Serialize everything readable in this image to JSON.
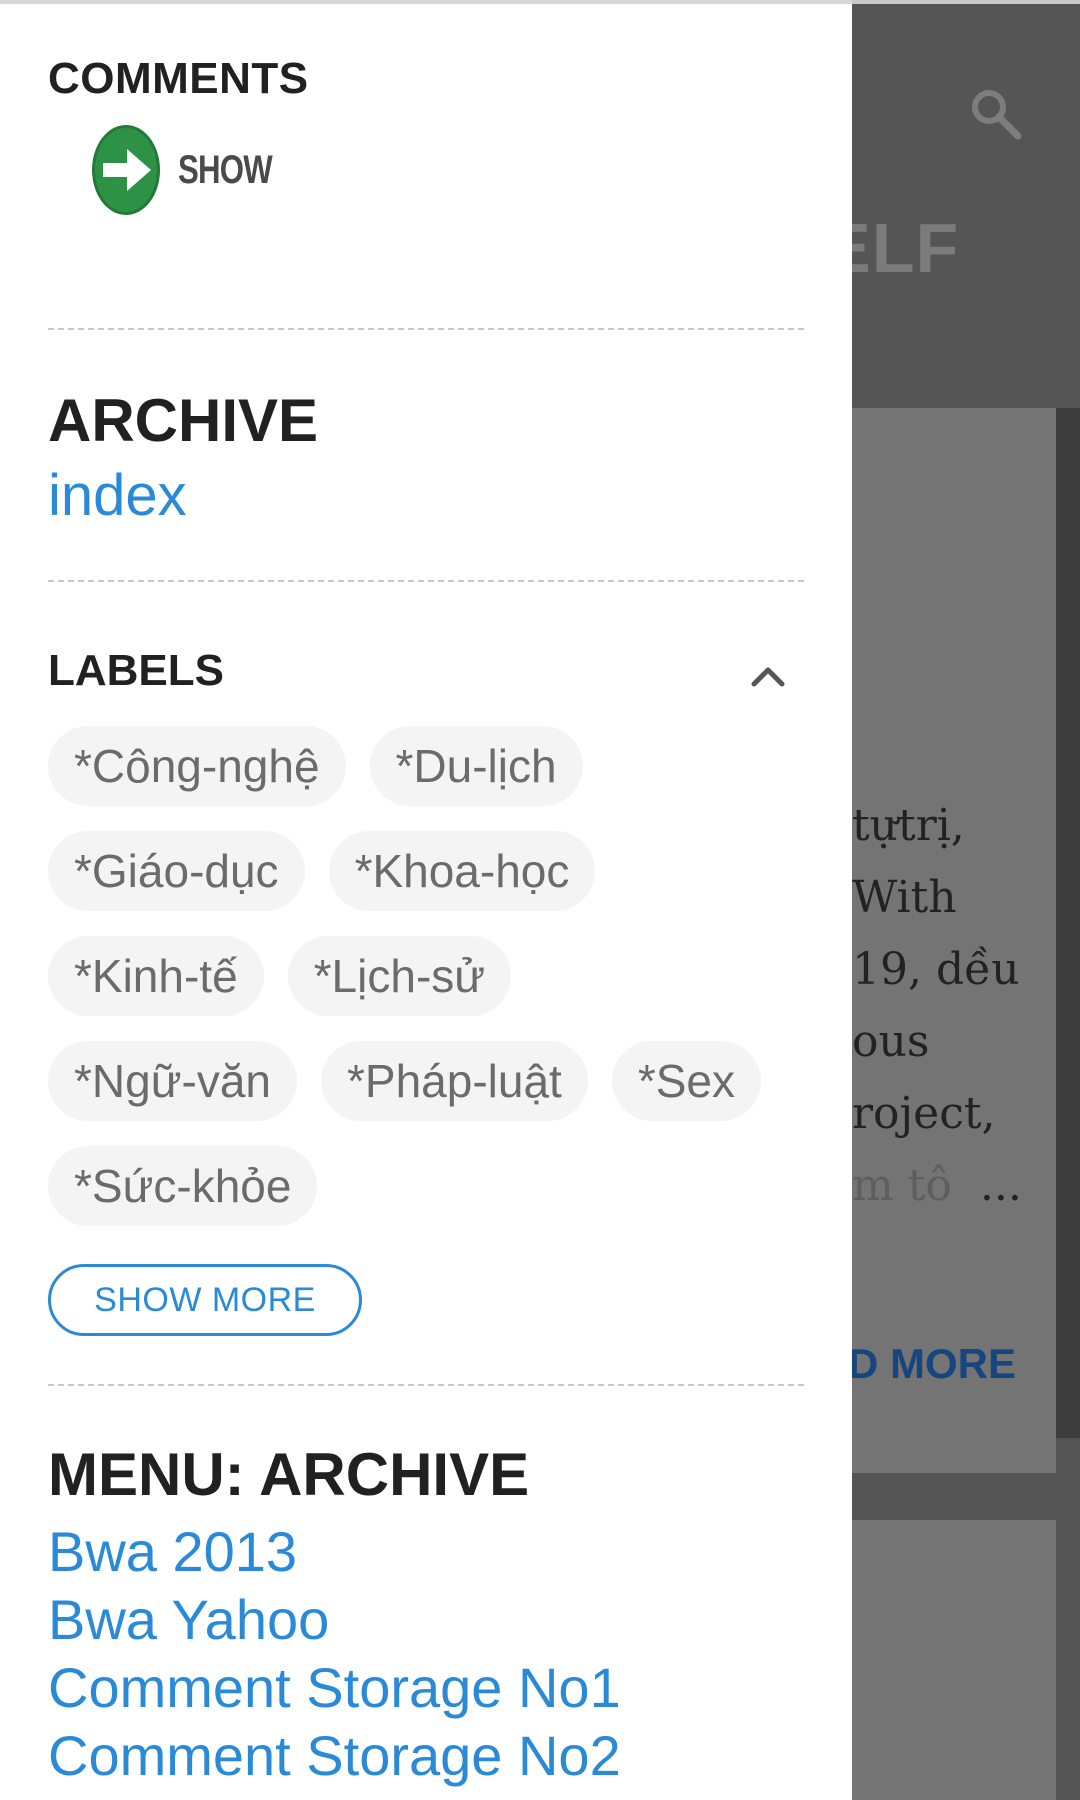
{
  "background": {
    "title_partial": "ELF",
    "excerpt_lines": [
      "tựtrị,",
      "With",
      "19, dều",
      "ous",
      "roject,"
    ],
    "excerpt_fade": "m tô",
    "excerpt_ellipsis": "...",
    "read_more_partial": "D MORE",
    "search_icon": "search-icon"
  },
  "drawer": {
    "comments": {
      "title": "COMMENTS",
      "show_button_label": "SHOW",
      "show_icon": "arrow-right-circle-icon"
    },
    "archive": {
      "title": "ARCHIVE",
      "link": "index"
    },
    "labels": {
      "title": "LABELS",
      "collapse_icon": "chevron-up-icon",
      "rows": [
        [
          "*Công-nghệ",
          "*Du-lịch"
        ],
        [
          "*Giáo-dục",
          "*Khoa-học"
        ],
        [
          "*Kinh-tế",
          "*Lịch-sử"
        ],
        [
          "*Ngữ-văn",
          "*Pháp-luật",
          "*Sex"
        ],
        [
          "*Sức-khỏe"
        ]
      ],
      "show_more": "SHOW MORE"
    },
    "menu_archive": {
      "title": "MENU: ARCHIVE",
      "links": [
        "Bwa 2013",
        "Bwa Yahoo",
        "Comment Storage No1",
        "Comment Storage No2"
      ]
    }
  },
  "colors": {
    "link_blue": "#2a8ad8",
    "title_dark": "#212121",
    "chip_bg": "#f4f4f4",
    "chip_text": "#6b6b6b",
    "overlay_gray": "#555555",
    "show_green": "#2e9246"
  }
}
